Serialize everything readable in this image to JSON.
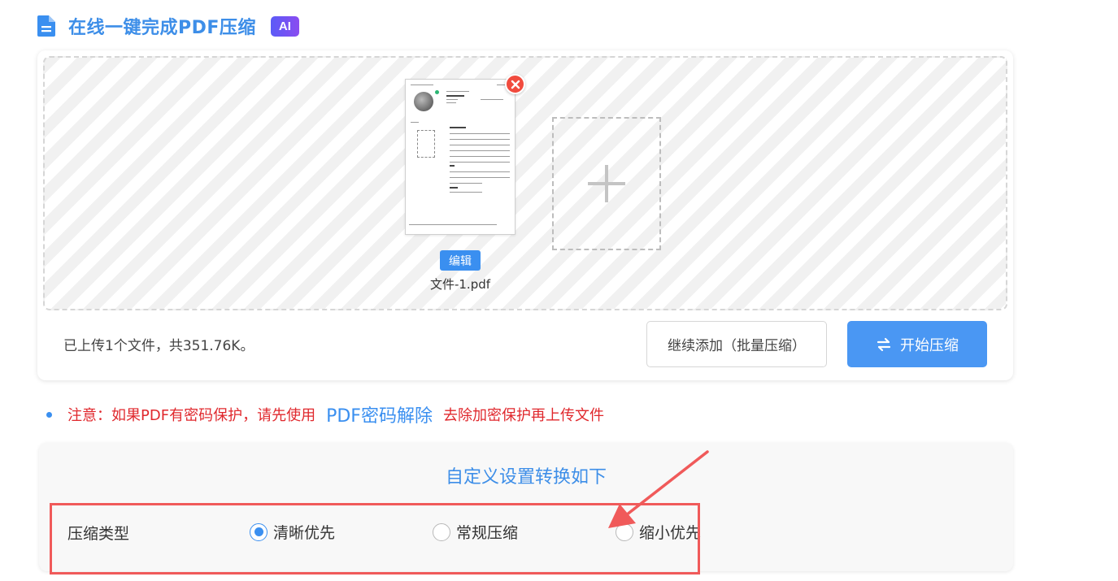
{
  "header": {
    "title": "在线一键完成PDF压缩",
    "ai_badge": "AI"
  },
  "upload": {
    "file": {
      "name": "文件-1.pdf",
      "edit_label": "编辑"
    },
    "status_text": "已上传1个文件，共351.76K。",
    "continue_label": "继续添加（批量压缩）",
    "start_label": "开始压缩"
  },
  "notice": {
    "prefix": "注意：如果PDF有密码保护，请先使用",
    "link": "PDF密码解除",
    "suffix": "去除加密保护再上传文件"
  },
  "settings": {
    "title": "自定义设置转换如下",
    "compress_type_label": "压缩类型",
    "options": [
      {
        "label": "清晰优先",
        "selected": true
      },
      {
        "label": "常规压缩",
        "selected": false
      },
      {
        "label": "缩小优先",
        "selected": false
      }
    ]
  },
  "colors": {
    "accent": "#3a8ff0",
    "warning": "#e0282d",
    "highlight": "#f05a5a"
  }
}
